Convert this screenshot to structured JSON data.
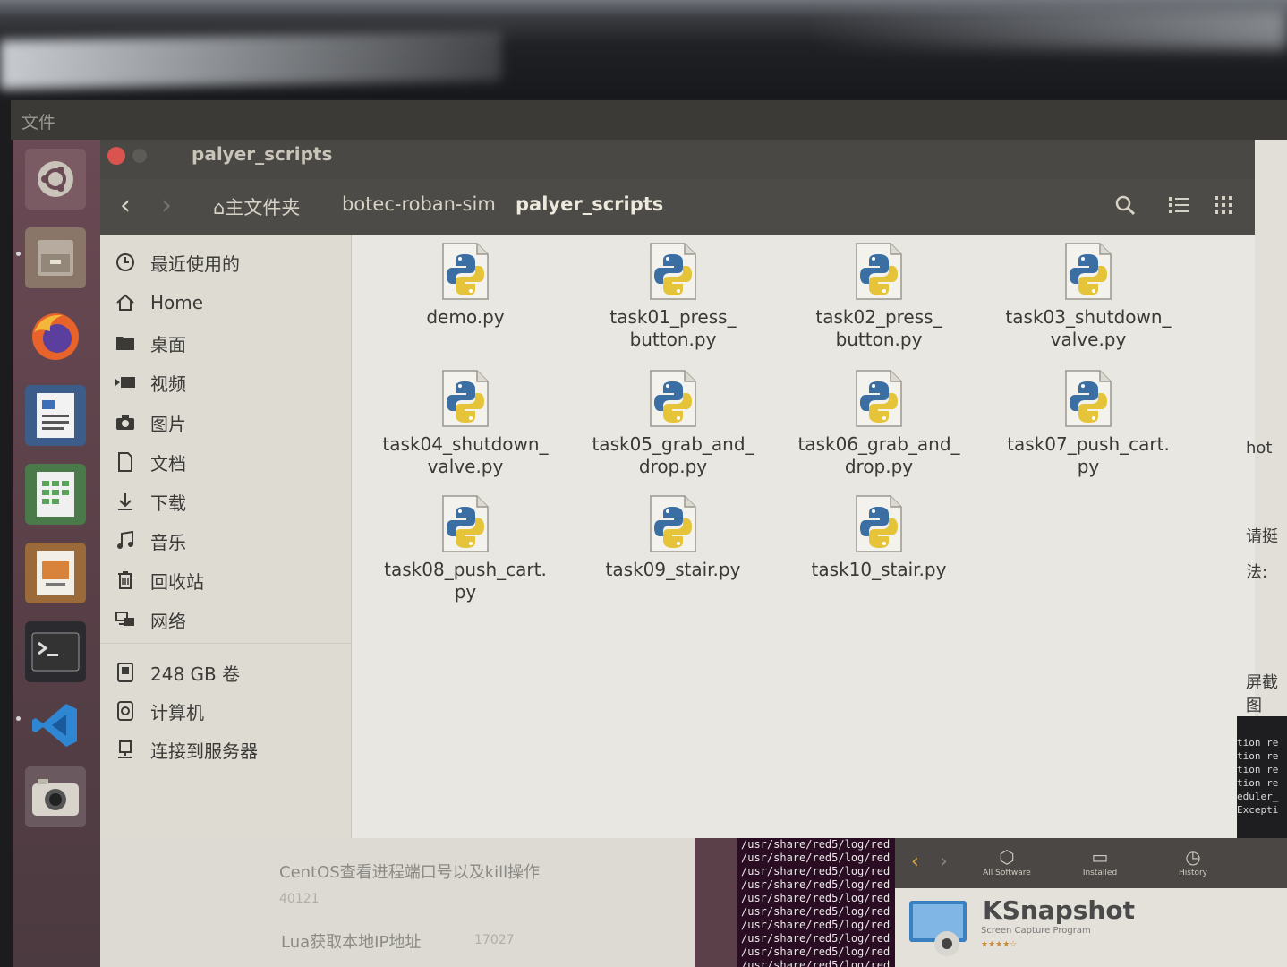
{
  "top_panel": {
    "menu_label": "文件"
  },
  "window": {
    "title": "palyer_scripts",
    "breadcrumbs": [
      "主文件夹",
      "botec-roban-sim",
      "palyer_scripts"
    ]
  },
  "sidebar": {
    "places": [
      {
        "label": "最近使用的",
        "icon": "clock-icon"
      },
      {
        "label": "Home",
        "icon": "home-icon"
      },
      {
        "label": "桌面",
        "icon": "folder-icon"
      },
      {
        "label": "视频",
        "icon": "video-icon"
      },
      {
        "label": "图片",
        "icon": "camera-icon"
      },
      {
        "label": "文档",
        "icon": "document-icon"
      },
      {
        "label": "下载",
        "icon": "download-icon"
      },
      {
        "label": "音乐",
        "icon": "music-icon"
      },
      {
        "label": "回收站",
        "icon": "trash-icon"
      },
      {
        "label": "网络",
        "icon": "network-icon"
      }
    ],
    "devices": [
      {
        "label": "248 GB 卷",
        "icon": "drive-icon"
      },
      {
        "label": "计算机",
        "icon": "computer-icon"
      },
      {
        "label": "连接到服务器",
        "icon": "server-icon"
      }
    ]
  },
  "files": [
    {
      "name": "demo.py"
    },
    {
      "name": "task01_press_\nbutton.py"
    },
    {
      "name": "task02_press_\nbutton.py"
    },
    {
      "name": "task03_shutdown_\nvalve.py"
    },
    {
      "name": "task04_shutdown_\nvalve.py"
    },
    {
      "name": "task05_grab_and_\ndrop.py"
    },
    {
      "name": "task06_grab_and_\ndrop.py"
    },
    {
      "name": "task07_push_cart.\npy"
    },
    {
      "name": "task08_push_cart.\npy"
    },
    {
      "name": "task09_stair.py"
    },
    {
      "name": "task10_stair.py"
    }
  ],
  "background": {
    "right_fragments": [
      "hot",
      "请挺",
      "法:",
      "屏截图"
    ],
    "right_terminal": [
      "tion re",
      "tion re",
      "tion re",
      "tion re",
      "eduler_",
      "Excepti"
    ],
    "articles": [
      {
        "title": "CentOS查看进程端口号以及kill操作",
        "count": "40121"
      },
      {
        "title": "Lua获取本地IP地址",
        "count": "17027"
      }
    ],
    "terminal_lines": [
      "/usr/share/red5/log/red",
      "/usr/share/red5/log/red",
      "/usr/share/red5/log/red",
      "/usr/share/red5/log/red",
      "/usr/share/red5/log/red",
      "/usr/share/red5/log/red",
      "/usr/share/red5/log/red",
      "/usr/share/red5/log/red",
      "/usr/share/red5/log/red",
      "/usr/share/red5/log/red"
    ],
    "software_center": {
      "tabs": [
        "All Software",
        "Installed",
        "History"
      ],
      "app_name": "KSnapshot",
      "app_subtitle": "Screen Capture Program"
    }
  }
}
